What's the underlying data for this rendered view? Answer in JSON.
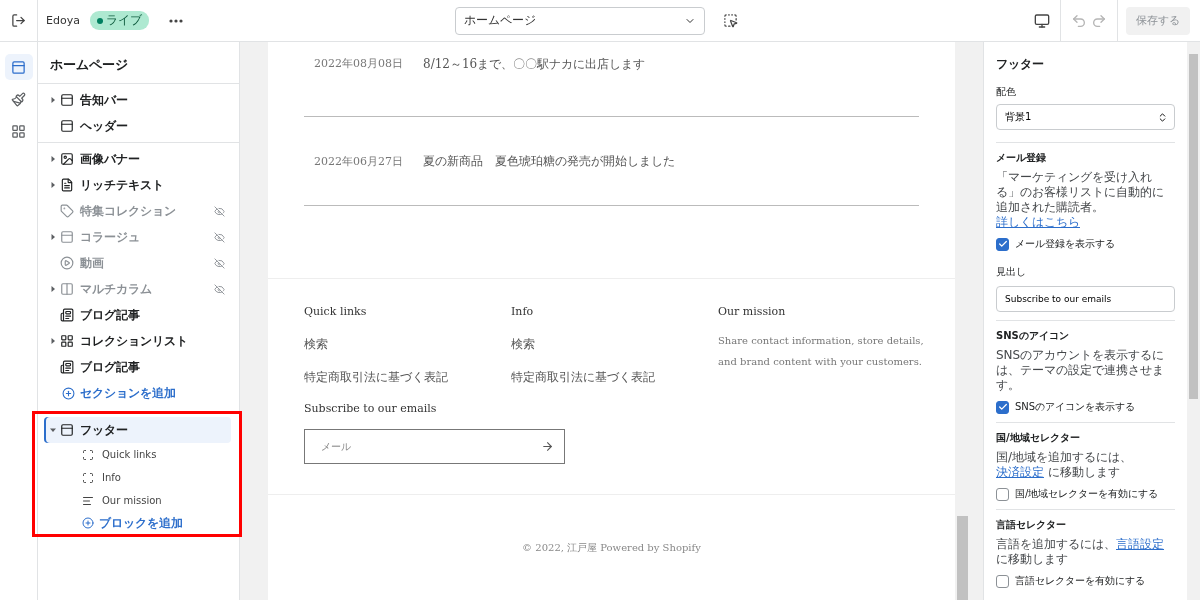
{
  "topbar": {
    "store_name": "Edoya",
    "status": "ライブ",
    "page_select": "ホームページ",
    "save_button": {
      "label": "保存する",
      "disabled": true
    }
  },
  "rail": [
    {
      "kind": "sections",
      "selected": true
    },
    {
      "kind": "theme",
      "selected": false
    },
    {
      "kind": "apps",
      "selected": false
    }
  ],
  "sidebar": {
    "title": "ホームページ",
    "header_items": [
      {
        "label": "告知バー",
        "kind": "bar",
        "expandable": true,
        "hidden": false
      },
      {
        "label": "ヘッダー",
        "kind": "bar",
        "expandable": false,
        "hidden": false
      }
    ],
    "template_items": [
      {
        "label": "画像バナー",
        "kind": "image",
        "expandable": true,
        "hidden": false
      },
      {
        "label": "リッチテキスト",
        "kind": "text",
        "expandable": true,
        "hidden": false
      },
      {
        "label": "特集コレクション",
        "kind": "tag",
        "expandable": false,
        "hidden": true
      },
      {
        "label": "コラージュ",
        "kind": "bar",
        "expandable": true,
        "hidden": true
      },
      {
        "label": "動画",
        "kind": "play",
        "expandable": false,
        "hidden": true
      },
      {
        "label": "マルチカラム",
        "kind": "columns",
        "expandable": true,
        "hidden": true
      },
      {
        "label": "ブログ記事",
        "kind": "blog",
        "expandable": false,
        "hidden": false
      },
      {
        "label": "コレクションリスト",
        "kind": "collection",
        "expandable": true,
        "hidden": false
      },
      {
        "label": "ブログ記事",
        "kind": "blog",
        "expandable": false,
        "hidden": false
      }
    ],
    "add_section": "セクションを追加",
    "footer": {
      "label": "フッター",
      "expanded": true,
      "selected": true,
      "blocks": [
        {
          "label": "Quick links",
          "kind": "menu"
        },
        {
          "label": "Info",
          "kind": "menu"
        },
        {
          "label": "Our mission",
          "kind": "text"
        }
      ],
      "add_block": "ブロックを追加"
    }
  },
  "preview": {
    "news": [
      {
        "date": "2022年08月08日",
        "title": "8/12～16まで、〇〇駅ナカに出店します"
      },
      {
        "date": "2022年06月27日",
        "title": "夏の新商品　夏色琥珀糖の発売が開始しました"
      }
    ],
    "footer_columns": [
      {
        "heading": "Quick links",
        "links": [
          "検索",
          "特定商取引法に基づく表記"
        ]
      },
      {
        "heading": "Info",
        "links": [
          "検索",
          "特定商取引法に基づく表記"
        ]
      },
      {
        "heading": "Our mission",
        "text": "Share contact information, store details, and brand content with your customers."
      }
    ],
    "subscribe_heading": "Subscribe to our emails",
    "email_placeholder": "メール",
    "copyright": "© 2022, 江戸屋 Powered by Shopify"
  },
  "settings": {
    "title": "フッター",
    "sections": [
      {
        "kind": "select",
        "label": "配色",
        "value": "背景1"
      },
      {
        "kind": "group",
        "heading": "メール登録",
        "text_before": "「マーケティングを受け入れる」のお客様リストに自動的に追加された購読者。",
        "link": "詳しくはこちら",
        "checkbox": {
          "label": "メール登録を表示する",
          "checked": true
        },
        "field": {
          "label": "見出し",
          "value": "Subscribe to our emails"
        }
      },
      {
        "kind": "group",
        "heading": "SNSのアイコン",
        "text_before": "SNSのアカウントを表示するには、テーマの設定で連携させます。",
        "checkbox": {
          "label": "SNSのアイコンを表示する",
          "checked": true
        }
      },
      {
        "kind": "group",
        "heading": "国/地域セレクター",
        "text_before": "国/地域を追加するには、",
        "link": "決済設定",
        "text_after": " に移動します",
        "checkbox": {
          "label": "国/地域セレクターを有効にする",
          "checked": false
        }
      },
      {
        "kind": "group",
        "heading": "言語セレクター",
        "text_before": "言語を追加するには、",
        "link": "言語設定",
        "text_after": " に移動します",
        "checkbox": {
          "label": "言語セレクターを有効にする",
          "checked": false
        }
      }
    ]
  }
}
